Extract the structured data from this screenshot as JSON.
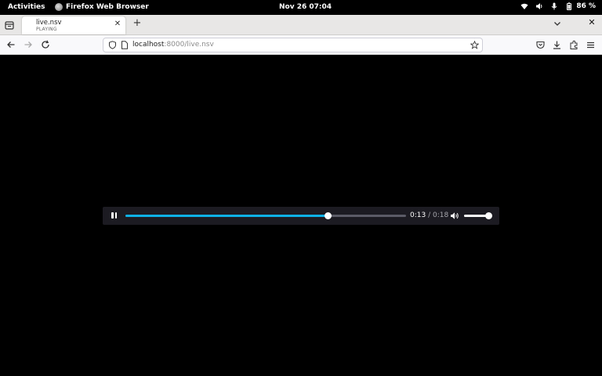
{
  "topbar": {
    "activities": "Activities",
    "app_name": "Firefox Web Browser",
    "clock": "Nov 26  07:04",
    "battery_percent": "86 %",
    "icons": [
      "wifi-icon",
      "speaker-icon",
      "microphone-icon",
      "battery-icon"
    ]
  },
  "tabs": [
    {
      "title": "live.nsv",
      "status": "PLAYING"
    }
  ],
  "navbar": {
    "url_host": "localhost",
    "url_rest": ":8000/live.nsv"
  },
  "player": {
    "state": "playing",
    "current_time": "0:13",
    "separator": " / ",
    "duration": "0:18",
    "progress_fraction": 0.72,
    "volume_fraction": 1.0,
    "accent_color": "#0eb1e6"
  }
}
